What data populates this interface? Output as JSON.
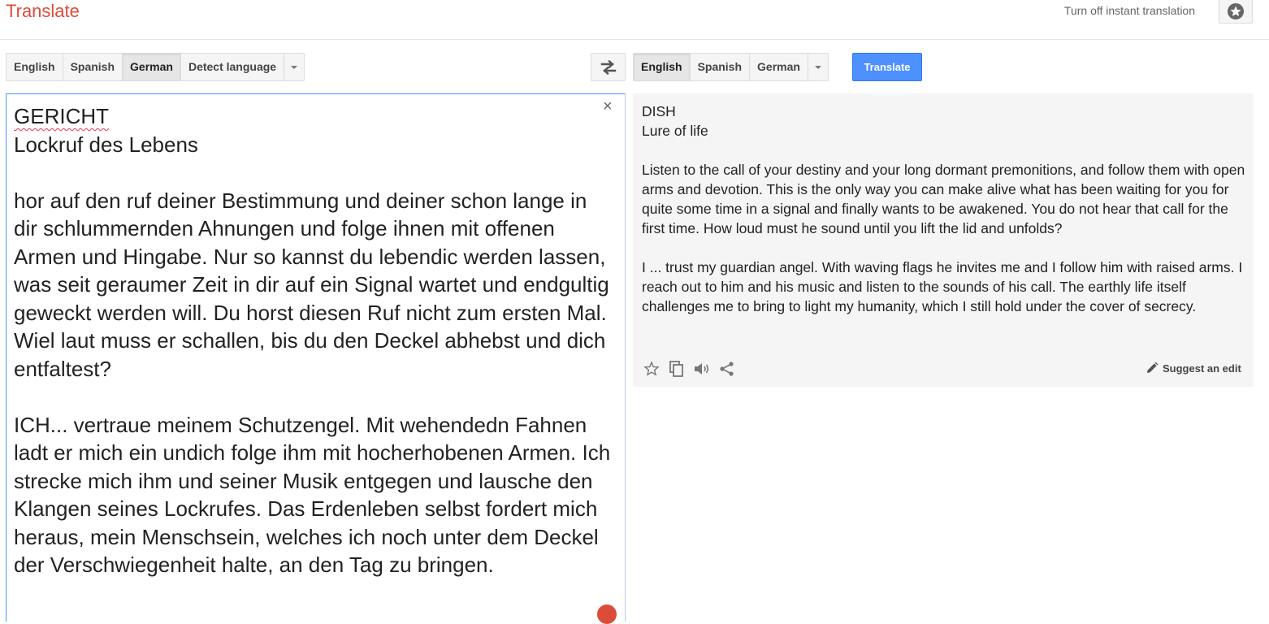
{
  "header": {
    "title": "Translate",
    "instant_toggle": "Turn off instant translation"
  },
  "source": {
    "languages": [
      "English",
      "Spanish",
      "German",
      "Detect language"
    ],
    "active_language": "German",
    "text": {
      "title": "GERICHT",
      "subtitle": "Lockruf des Lebens",
      "paragraph1": "hor auf den ruf deiner Bestimmung und deiner schon lange in dir schlummernden Ahnungen und folge ihnen mit offenen Armen und Hingabe. Nur so kannst du lebendic werden lassen, was seit geraumer Zeit in dir auf ein Signal wartet und endgultig geweckt werden will. Du horst diesen Ruf nicht zum ersten Mal. Wiel laut muss er schallen, bis du den Deckel abhebst und dich entfaltest?",
      "paragraph2": "ICH... vertraue meinem Schutzengel. Mit wehendedn Fahnen ladt er mich ein undich folge ihm mit hocherhobenen Armen. Ich strecke mich ihm und seiner Musik entgegen und lausche den Klangen seines Lockrufes. Das Erdenleben selbst fordert mich heraus, mein Menschsein, welches ich noch unter dem Deckel der Verschwiegenheit halte, an den Tag zu bringen."
    },
    "clear_symbol": "×"
  },
  "target": {
    "languages": [
      "English",
      "Spanish",
      "German"
    ],
    "active_language": "English",
    "translate_label": "Translate",
    "text": {
      "title": "DISH",
      "subtitle": "Lure of life",
      "paragraph1": "Listen to the call of your destiny and your long dormant premonitions, and follow them with open arms and devotion. This is the only way you can make alive what has been waiting for you for quite some time in a signal and finally wants to be awakened. You do not hear that call for the first time. How loud must he sound until you lift the lid and unfolds?",
      "paragraph2": "I ... trust my guardian angel. With waving flags he invites me and I follow him with raised arms. I reach out to him and his music and listen to the sounds of his call. The earthly life itself challenges me to bring to light my humanity, which I still hold under the cover of secrecy."
    },
    "actions": [
      "star-icon",
      "copy-icon",
      "speaker-icon",
      "share-icon"
    ],
    "suggest_label": "Suggest an edit"
  },
  "colors": {
    "brand_red": "#dd4b39",
    "primary_blue": "#4d90fe",
    "result_bg": "#f5f5f5"
  }
}
